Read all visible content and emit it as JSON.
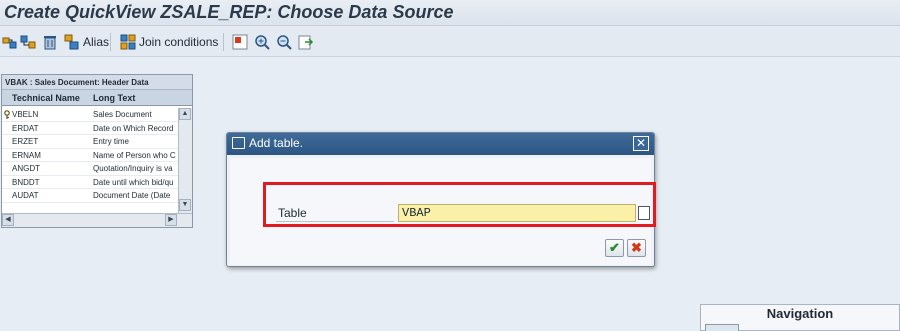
{
  "window": {
    "title": "Create QuickView ZSALE_REP: Choose Data Source"
  },
  "toolbar": {
    "alias_label": "Alias",
    "join_label": "Join conditions"
  },
  "table_panel": {
    "title": "VBAK : Sales Document: Header Data",
    "headers": [
      "Technical Name",
      "Long Text"
    ],
    "rows": [
      {
        "name": "VBELN",
        "text": "Sales Document"
      },
      {
        "name": "ERDAT",
        "text": "Date on Which Record"
      },
      {
        "name": "ERZET",
        "text": "Entry time"
      },
      {
        "name": "ERNAM",
        "text": "Name of Person who C"
      },
      {
        "name": "ANGDT",
        "text": "Quotation/Inquiry is va"
      },
      {
        "name": "BNDDT",
        "text": "Date until which bid/qu"
      },
      {
        "name": "AUDAT",
        "text": "Document Date (Date"
      }
    ]
  },
  "dialog": {
    "title": "Add table.",
    "field_label": "Table",
    "field_value": "VBAP"
  },
  "navigation": {
    "title": "Navigation"
  }
}
